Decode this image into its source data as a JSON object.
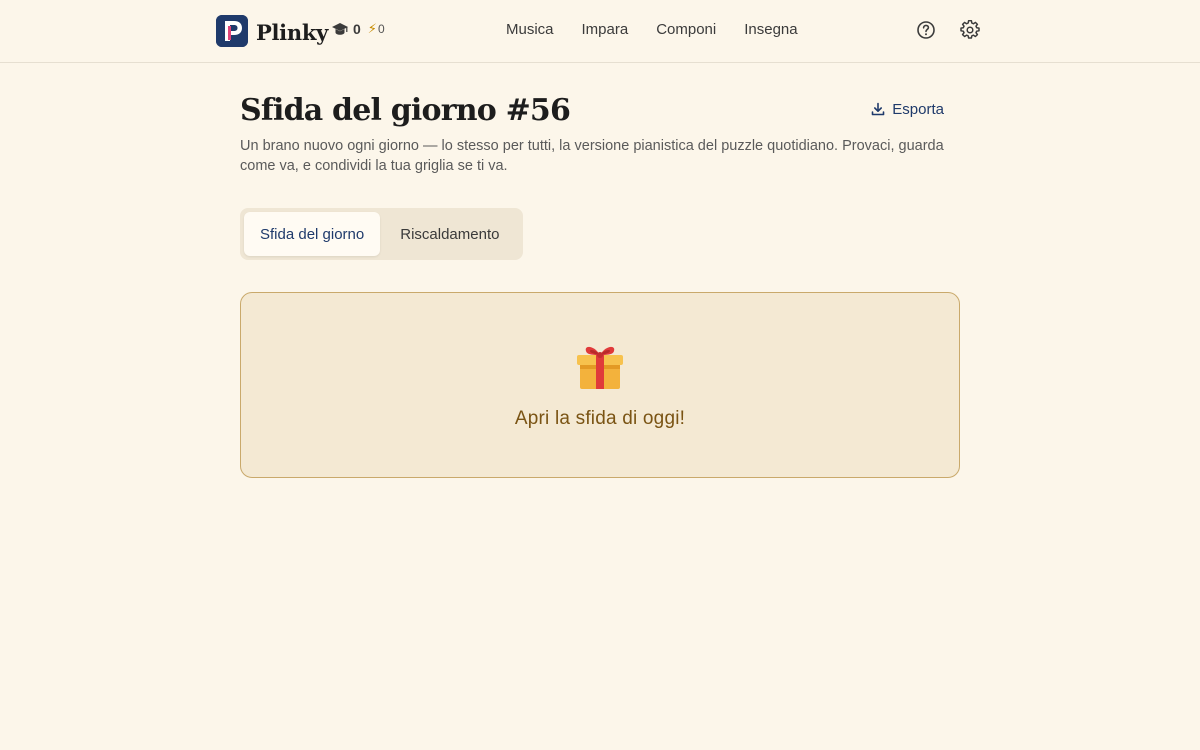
{
  "app": {
    "name": "Plinky",
    "logo_letter": "P"
  },
  "stats": {
    "streak": "0",
    "energy": "0"
  },
  "nav": {
    "items": [
      {
        "label": "Musica"
      },
      {
        "label": "Impara"
      },
      {
        "label": "Componi"
      },
      {
        "label": "Insegna"
      }
    ]
  },
  "page": {
    "title": "Sfida del giorno #56",
    "subtitle": "Un brano nuovo ogni giorno — lo stesso per tutti, la versione pianistica del puzzle quotidiano. Provaci, guarda come va, e condividi la tua griglia se ti va.",
    "export_label": "Esporta"
  },
  "tabs": [
    {
      "label": "Sfida del giorno",
      "active": true
    },
    {
      "label": "Riscaldamento",
      "active": false
    }
  ],
  "challenge": {
    "cta_label": "Apri la sfida di oggi!",
    "icon": "gift-icon"
  },
  "colors": {
    "background": "#fcf6ea",
    "brand": "#1f3a6b",
    "accent_pink": "#e0457b",
    "card_bg": "#f4e9d3",
    "card_border": "#c9a96b",
    "cta_text": "#7a5414"
  }
}
